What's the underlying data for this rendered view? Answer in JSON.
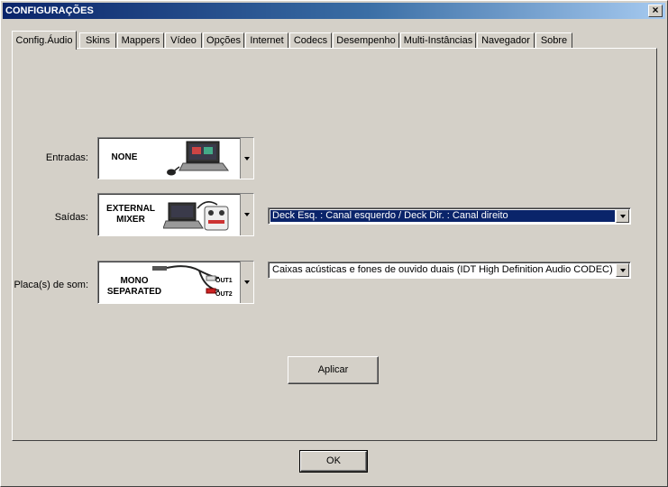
{
  "window": {
    "title": "CONFIGURAÇÕES",
    "close_label": "×"
  },
  "tabs": [
    {
      "label": "Config.Áudio"
    },
    {
      "label": "Skins"
    },
    {
      "label": "Mappers"
    },
    {
      "label": "Vídeo"
    },
    {
      "label": "Opções"
    },
    {
      "label": "Internet"
    },
    {
      "label": "Codecs"
    },
    {
      "label": "Desempenho"
    },
    {
      "label": "Multi-Instâncias"
    },
    {
      "label": "Navegador"
    },
    {
      "label": "Sobre"
    }
  ],
  "active_tab": "Config.Áudio",
  "rows": {
    "inputs": {
      "label": "Entradas:",
      "selection_text": "NONE",
      "picture": "laptop-with-mouse"
    },
    "outputs": {
      "label": "Saídas:",
      "selection_text_line1": "EXTERNAL",
      "selection_text_line2": "MIXER",
      "picture": "laptop-with-mixer",
      "dropdown_value": "Deck Esq. : Canal esquerdo / Deck Dir. : Canal direito"
    },
    "soundcard": {
      "label": "Placa(s) de som:",
      "selection_text_line1": "MONO",
      "selection_text_line2": "SEPARATED",
      "picture": "rca-split-cable",
      "out1": "OUT1",
      "out2": "OUT2",
      "dropdown_value": "Caixas acústicas e fones de ouvido duais (IDT High Definition Audio CODEC)"
    }
  },
  "buttons": {
    "apply_label": "Aplicar",
    "ok_label": "OK"
  },
  "colors": {
    "titlebar_start": "#0a246a",
    "titlebar_end": "#a6caf0",
    "face": "#d4d0c8",
    "selection": "#0a246a"
  }
}
